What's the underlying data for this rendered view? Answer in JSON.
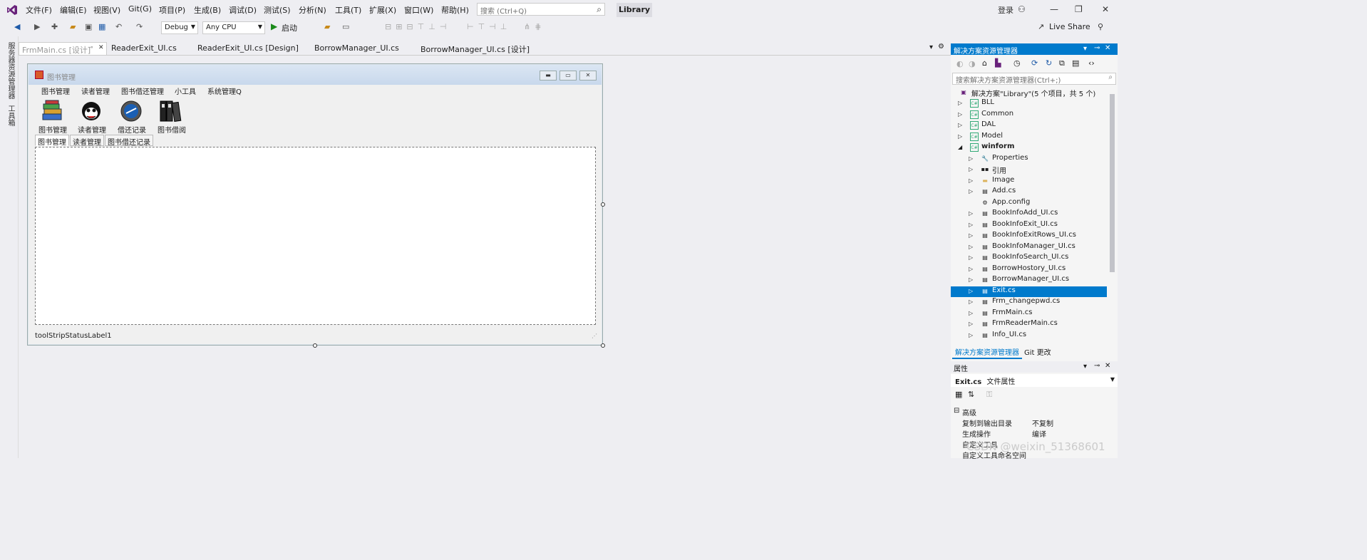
{
  "menubar": {
    "items": [
      "文件(F)",
      "编辑(E)",
      "视图(V)",
      "Git(G)",
      "项目(P)",
      "生成(B)",
      "调试(D)",
      "测试(S)",
      "分析(N)",
      "工具(T)",
      "扩展(X)",
      "窗口(W)",
      "帮助(H)"
    ],
    "search_placeholder": "搜索 (Ctrl+Q)",
    "solution_name": "Library",
    "login": "登录"
  },
  "toolbar": {
    "config": "Debug",
    "platform": "Any CPU",
    "start": "启动",
    "live_share": "Live Share"
  },
  "left_strip": {
    "server_explorer": "服务器资源管理器",
    "toolbox": "工具箱"
  },
  "doc_tabs": [
    {
      "label": "FrmMain.cs [设计]"
    },
    {
      "label": "ReaderExit_UI.cs"
    },
    {
      "label": "ReaderExit_UI.cs [Design]"
    },
    {
      "label": "BorrowManager_UI.cs"
    },
    {
      "label": "BorrowManager_UI.cs [设计]"
    }
  ],
  "form": {
    "title": "图书管理",
    "menu": [
      "图书管理",
      "读者管理",
      "图书借还管理",
      "小工具",
      "系统管理Q"
    ],
    "tools": [
      "图书管理",
      "读者管理",
      "借还记录",
      "图书借阅"
    ],
    "tabs": [
      "图书管理",
      "读者管理",
      "图书借还记录"
    ],
    "status": "toolStripStatusLabel1"
  },
  "solution_explorer": {
    "title": "解决方案资源管理器",
    "search_placeholder": "搜索解决方案资源管理器(Ctrl+;)",
    "root": "解决方案\"Library\"(5 个项目，共 5 个)",
    "items": [
      {
        "label": "BLL"
      },
      {
        "label": "Common"
      },
      {
        "label": "DAL"
      },
      {
        "label": "Model"
      },
      {
        "label": "winform"
      },
      {
        "label": "Properties"
      },
      {
        "label": "引用"
      },
      {
        "label": "Image"
      },
      {
        "label": "Add.cs"
      },
      {
        "label": "App.config"
      },
      {
        "label": "BookInfoAdd_UI.cs"
      },
      {
        "label": "BookInfoExit_UI.cs"
      },
      {
        "label": "BookInfoExitRows_UI.cs"
      },
      {
        "label": "BookInfoManager_UI.cs"
      },
      {
        "label": "BookInfoSearch_UI.cs"
      },
      {
        "label": "BorrowHostory_UI.cs"
      },
      {
        "label": "BorrowManager_UI.cs"
      },
      {
        "label": "Exit.cs"
      },
      {
        "label": "Frm_changepwd.cs"
      },
      {
        "label": "FrmMain.cs"
      },
      {
        "label": "FrmReaderMain.cs"
      },
      {
        "label": "Info_UI.cs"
      }
    ],
    "bottom_tabs": [
      "解决方案资源管理器",
      "Git 更改"
    ]
  },
  "properties": {
    "title": "属性",
    "object": "Exit.cs",
    "object_type": "文件属性",
    "category": "高级",
    "rows": [
      {
        "name": "复制到输出目录",
        "value": "不复制"
      },
      {
        "name": "生成操作",
        "value": "编译"
      },
      {
        "name": "自定义工具",
        "value": ""
      },
      {
        "name": "自定义工具命名空间",
        "value": ""
      }
    ]
  },
  "watermark": "CSDN @weixin_51368601",
  "colors": {
    "accent": "#007acc",
    "vs_purple": "#68217a",
    "bg": "#eeeef2"
  }
}
